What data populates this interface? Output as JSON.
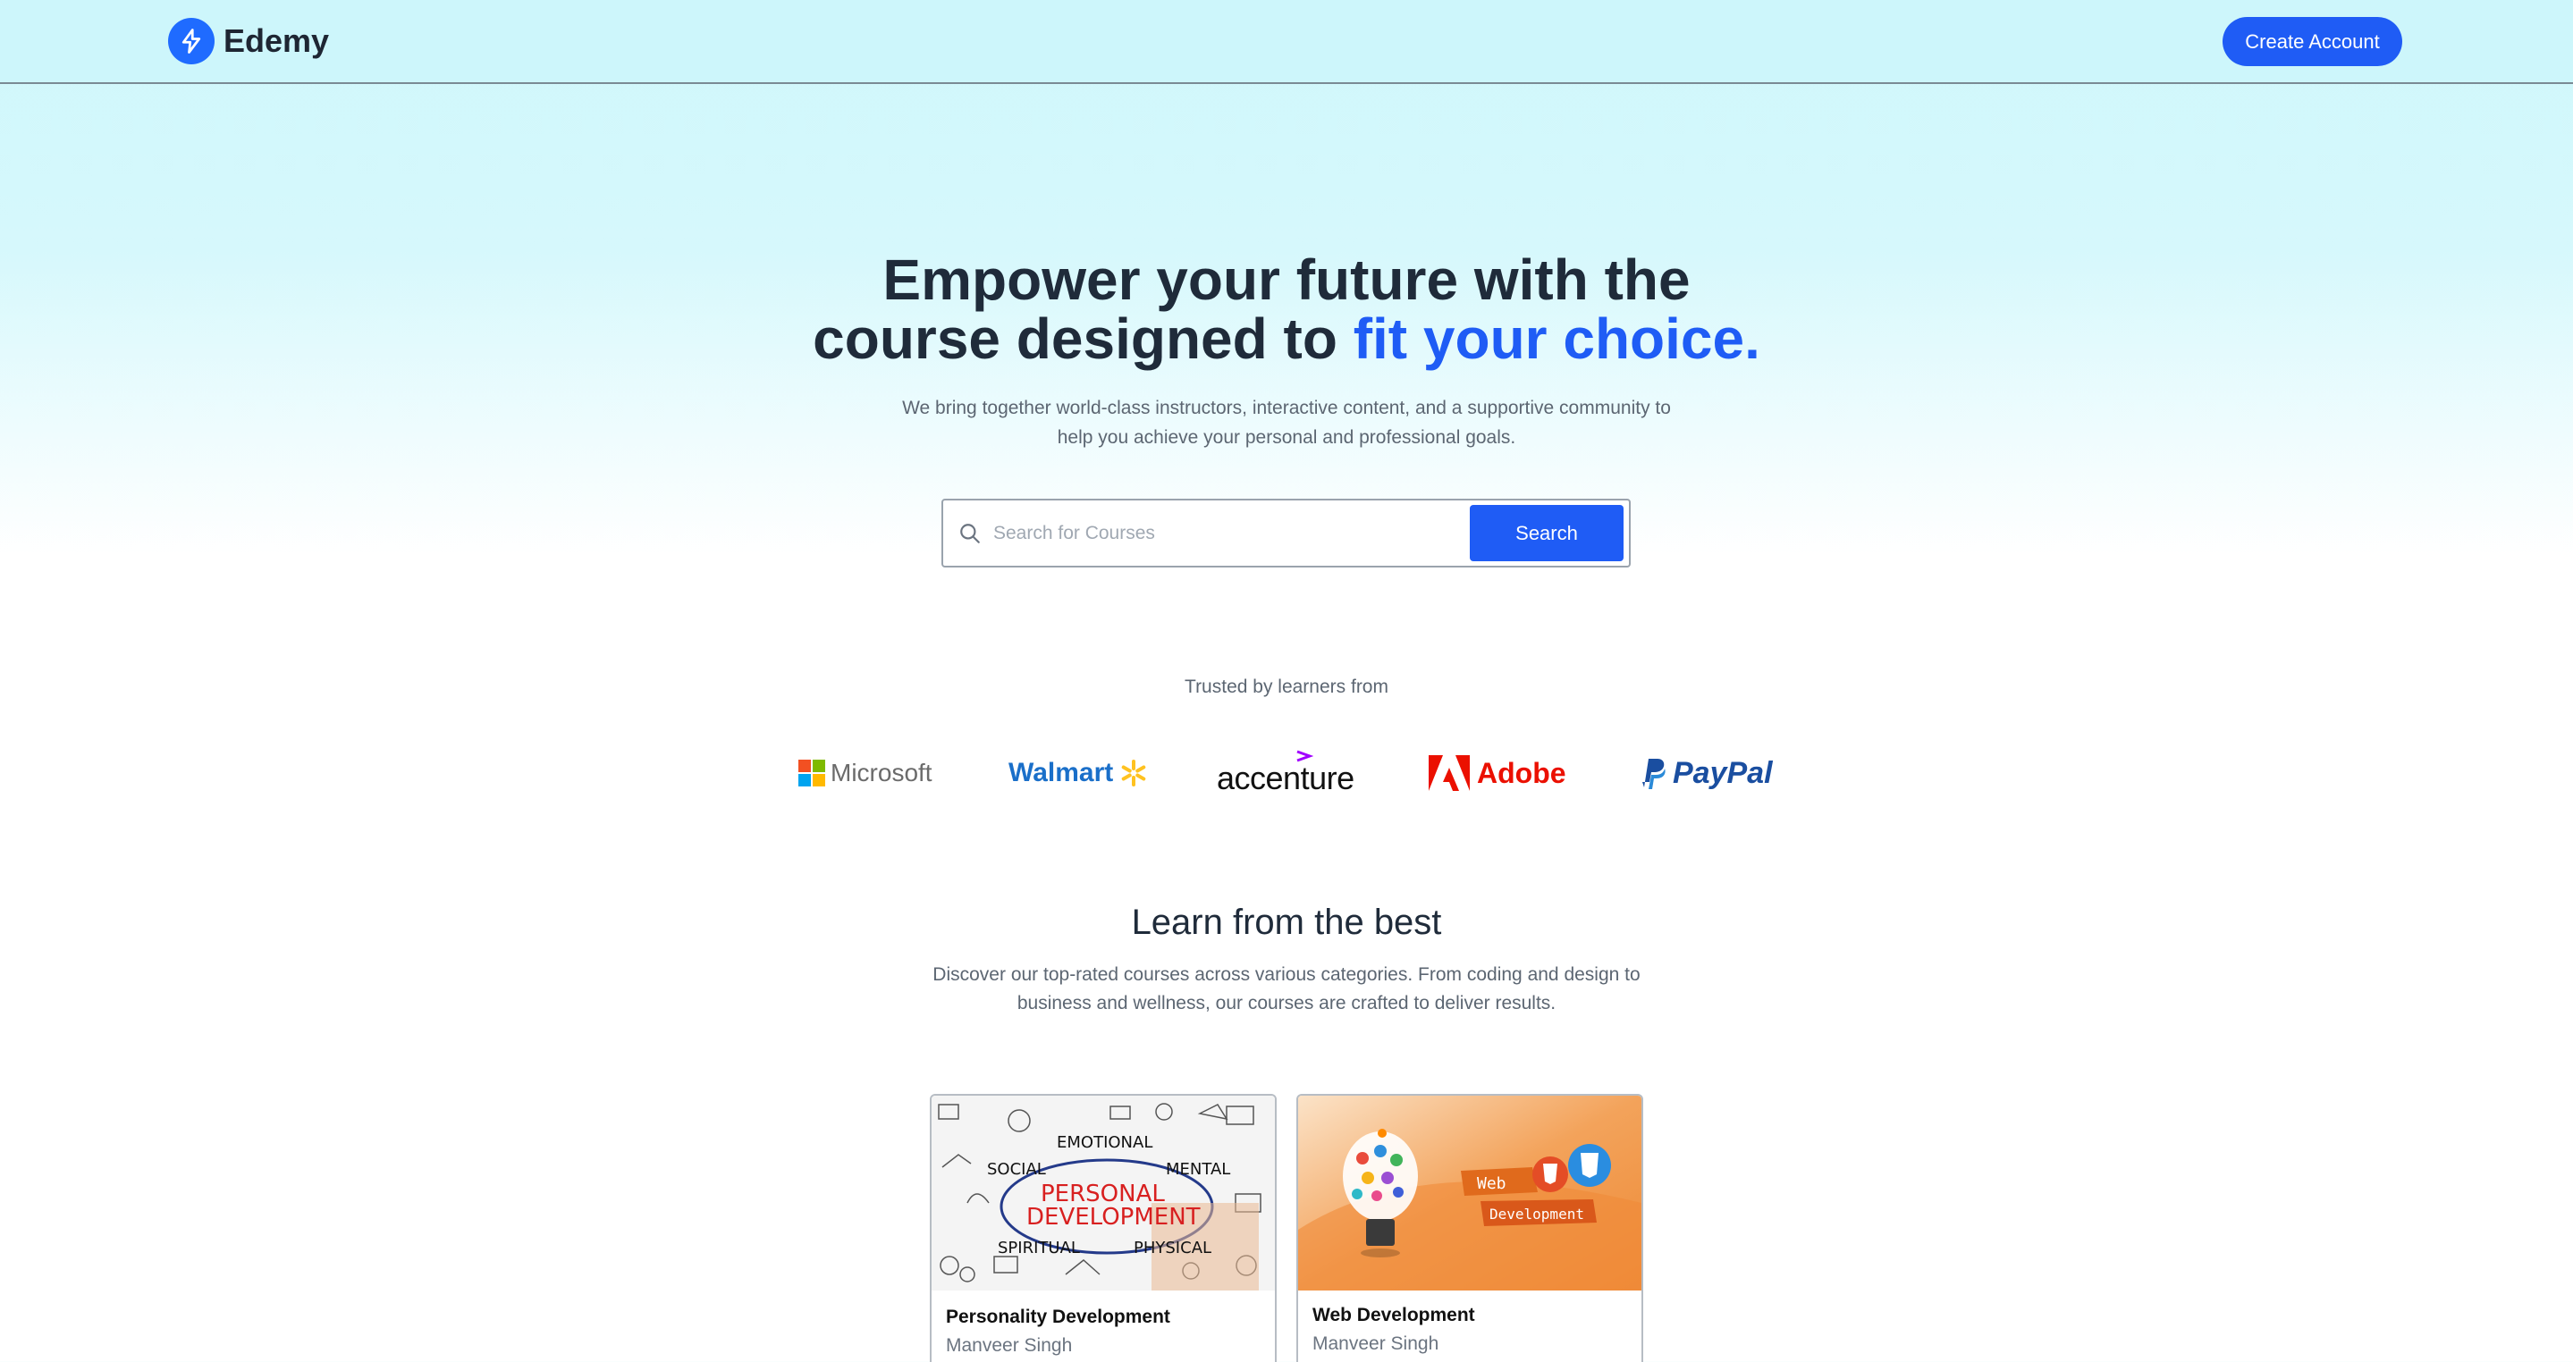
{
  "header": {
    "brand": "Edemy",
    "create_account": "Create Account"
  },
  "hero": {
    "title_line1": "Empower your future with the",
    "title_line2_plain": "course designed to ",
    "title_line2_accent": "fit your choice.",
    "subtitle_line1": "We bring together world-class instructors, interactive content, and a supportive community to",
    "subtitle_line2": "help you achieve your personal and professional goals."
  },
  "search": {
    "placeholder": "Search for Courses",
    "value": "",
    "button": "Search"
  },
  "trusted": {
    "label": "Trusted by learners from",
    "companies": [
      "Microsoft",
      "Walmart",
      "accenture",
      "Adobe",
      "PayPal"
    ]
  },
  "learn": {
    "title": "Learn from the best",
    "subtitle_line1": "Discover our top-rated courses across various categories. From coding and design to",
    "subtitle_line2": "business and wellness, our courses are crafted to deliver results."
  },
  "courses": [
    {
      "title": "Personality Development",
      "author": "Manveer Singh",
      "image_words": [
        "EMOTIONAL",
        "SOCIAL",
        "MENTAL",
        "PERSONAL",
        "DEVELOPMENT",
        "SPIRITUAL",
        "PHYSICAL"
      ]
    },
    {
      "title": "Web Development",
      "author": "Manveer Singh",
      "image_words": [
        "Web",
        "Development"
      ]
    }
  ],
  "colors": {
    "accent": "#1f5cf5",
    "header_bg": "#cdf6fb",
    "heading": "#1f2b3a",
    "muted": "#5c6672"
  },
  "icons": [
    "bolt-logo-icon",
    "search-icon"
  ]
}
